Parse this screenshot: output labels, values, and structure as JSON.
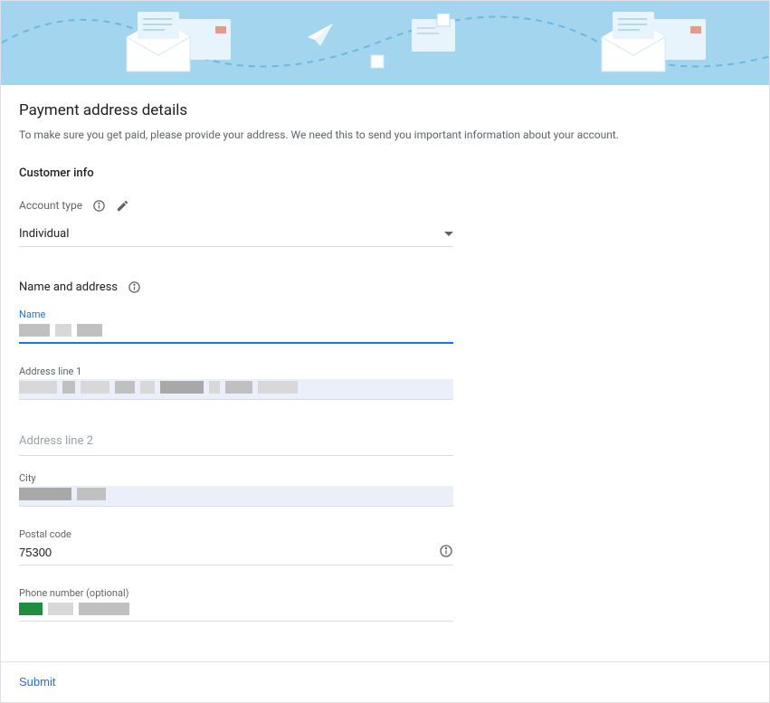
{
  "page": {
    "title": "Payment address details",
    "description": "To make sure you get paid, please provide your address. We need this to send you important information about your account."
  },
  "customer_info": {
    "section_title": "Customer info",
    "account_type": {
      "label": "Account type",
      "selected": "Individual"
    }
  },
  "name_address": {
    "section_title": "Name and address",
    "name_label": "Name",
    "address1_label": "Address line 1",
    "address2_label": "Address line 2",
    "city_label": "City",
    "postal_code_label": "Postal code",
    "postal_code_value": "75300",
    "phone_label": "Phone number (optional)"
  },
  "footer": {
    "submit_label": "Submit"
  }
}
